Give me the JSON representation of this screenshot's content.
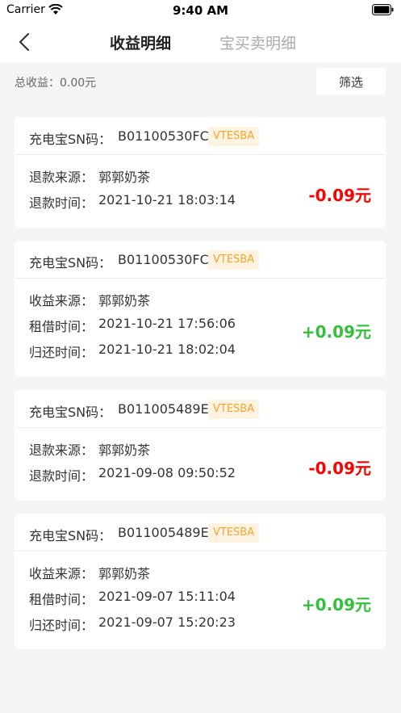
{
  "status_bar": {
    "carrier": "Carrier",
    "time": "9:40 AM"
  },
  "nav": {
    "active_tab": "收益明细",
    "inactive_tab": "宝买卖明细"
  },
  "summary": {
    "total_label": "总收益：0.00元",
    "filter_label": "筛选"
  },
  "colors": {
    "negative": "#ff0000",
    "positive": "#33c13c",
    "badge_text": "#f2a530",
    "badge_bg": "#fdf3e0"
  },
  "records": [
    {
      "sn_label": "充电宝SN码：",
      "sn": "B01100530FC",
      "badge": "VTESBA",
      "rows": [
        {
          "label": "退款来源：",
          "value": "郭郭奶茶"
        },
        {
          "label": "退款时间：",
          "value": "2021-10-21 18:03:14"
        }
      ],
      "amount": "-0.09元"
    },
    {
      "sn_label": "充电宝SN码：",
      "sn": "B01100530FC",
      "badge": "VTESBA",
      "rows": [
        {
          "label": "收益来源：",
          "value": "郭郭奶茶"
        },
        {
          "label": "租借时间：",
          "value": "2021-10-21 17:56:06"
        },
        {
          "label": "归还时间：",
          "value": "2021-10-21 18:02:04"
        }
      ],
      "amount": "+0.09元"
    },
    {
      "sn_label": "充电宝SN码：",
      "sn": "B011005489E",
      "badge": "VTESBA",
      "rows": [
        {
          "label": "退款来源：",
          "value": "郭郭奶茶"
        },
        {
          "label": "退款时间：",
          "value": "2021-09-08 09:50:52"
        }
      ],
      "amount": "-0.09元"
    },
    {
      "sn_label": "充电宝SN码：",
      "sn": "B011005489E",
      "badge": "VTESBA",
      "rows": [
        {
          "label": "收益来源：",
          "value": "郭郭奶茶"
        },
        {
          "label": "租借时间：",
          "value": "2021-09-07 15:11:04"
        },
        {
          "label": "归还时间：",
          "value": "2021-09-07 15:20:23"
        }
      ],
      "amount": "+0.09元"
    }
  ]
}
